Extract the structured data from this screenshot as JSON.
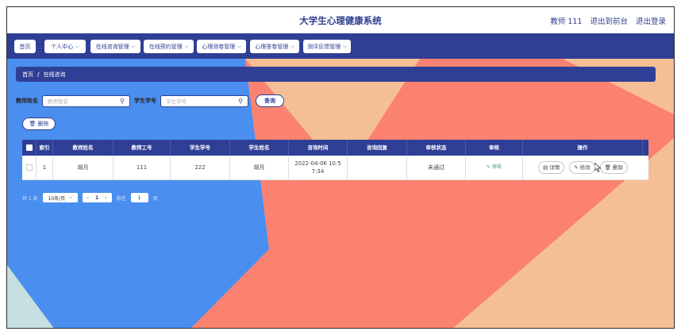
{
  "header": {
    "title": "大学生心理健康系统",
    "user": "教师 111",
    "front_link": "退出到前台",
    "logout_link": "退出登录"
  },
  "nav": {
    "items": [
      {
        "label": "首页",
        "has_dropdown": false
      },
      {
        "label": "个人中心",
        "has_dropdown": true
      },
      {
        "label": "在线咨询管理",
        "has_dropdown": true
      },
      {
        "label": "在线预约管理",
        "has_dropdown": true
      },
      {
        "label": "心理测卷管理",
        "has_dropdown": true
      },
      {
        "label": "心理答卷管理",
        "has_dropdown": true
      },
      {
        "label": "测评反馈管理",
        "has_dropdown": true
      }
    ]
  },
  "breadcrumb": {
    "home": "首页",
    "separator": "/",
    "current": "在线咨询"
  },
  "search": {
    "teacher_label": "教师姓名",
    "teacher_placeholder": "教师姓名",
    "student_label": "学生学号",
    "student_placeholder": "学生学号",
    "query_button": "查询"
  },
  "actions": {
    "delete_button": "删除"
  },
  "table": {
    "columns": [
      "索引",
      "教师姓名",
      "教师工号",
      "学生学号",
      "学生姓名",
      "咨询时间",
      "咨询回复",
      "审核状态",
      "审核",
      "操作"
    ],
    "rows": [
      {
        "index": "1",
        "teacher_name": "胡月",
        "teacher_no": "111",
        "student_no": "222",
        "student_name": "胡月",
        "time": "2022-04-06 10:57:34",
        "reply": "",
        "status": "未通过",
        "review": "审核",
        "ops": {
          "detail": "详情",
          "edit": "修改",
          "delete": "删除"
        }
      }
    ]
  },
  "pagination": {
    "total": "共 1 条",
    "page_size": "10条/页",
    "current_page": "1",
    "goto_label": "前往",
    "goto_value": "1",
    "page_suffix": "页"
  },
  "colors": {
    "primary": "#2f3f96",
    "bg_blue": "#4a8ff0",
    "bg_red": "#fb8270",
    "bg_peach": "#f5bf96",
    "bg_pale": "#c6dfe1"
  }
}
